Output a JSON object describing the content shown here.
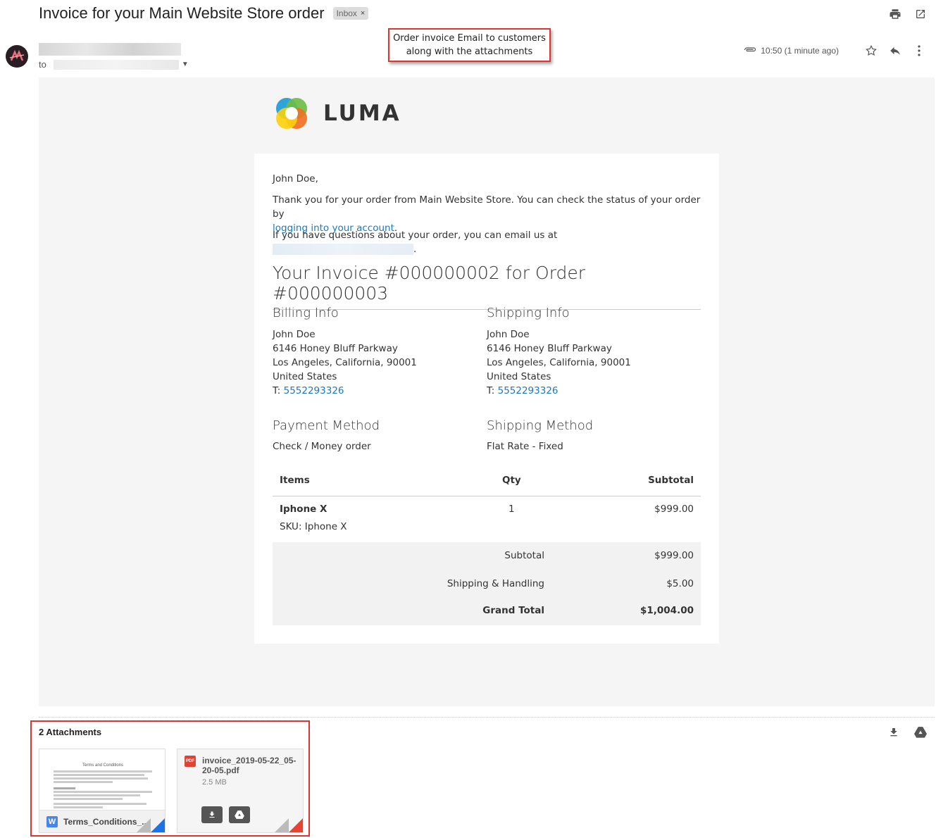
{
  "header": {
    "subject": "Invoice for your Main Website Store order",
    "label_chip": "Inbox",
    "chip_close": "×",
    "to_label": "to",
    "time": "10:50 (1 minute ago)"
  },
  "annotation": {
    "line1": "Order invoice Email to customers",
    "line2": "along with the attachments"
  },
  "email": {
    "brand": "LUMA",
    "greeting": "John Doe,",
    "thanks_line1": "Thank you for your order from Main Website Store. You can check the status of your order by",
    "login_link": "logging into your account",
    "period": ".",
    "questions": "If you have questions about your order, you can email us at",
    "invoice_title": "Your Invoice #000000002 for Order #000000003",
    "billing": {
      "heading": "Billing Info",
      "name": "John Doe",
      "street": "6146 Honey Bluff Parkway",
      "city": "Los Angeles, California, 90001",
      "country": "United States",
      "phone_prefix": "T:",
      "phone": "5552293326"
    },
    "shipping": {
      "heading": "Shipping Info",
      "name": "John Doe",
      "street": "6146 Honey Bluff Parkway",
      "city": "Los Angeles, California, 90001",
      "country": "United States",
      "phone_prefix": "T:",
      "phone": "5552293326"
    },
    "payment": {
      "heading": "Payment Method",
      "value": "Check / Money order"
    },
    "ship_method": {
      "heading": "Shipping Method",
      "value": "Flat Rate - Fixed"
    },
    "table": {
      "headers": [
        "Items",
        "Qty",
        "Subtotal"
      ],
      "rows": [
        {
          "name": "Iphone X",
          "sku": "SKU: Iphone X",
          "qty": "1",
          "subtotal": "$999.00"
        }
      ]
    },
    "totals": {
      "subtotal_label": "Subtotal",
      "subtotal": "$999.00",
      "shipping_label": "Shipping & Handling",
      "shipping": "$5.00",
      "grand_label": "Grand Total",
      "grand": "$1,004.00"
    }
  },
  "attachments": {
    "title": "2 Attachments",
    "files": [
      {
        "name": "Terms_Conditions_...",
        "type_letter": "W",
        "preview_title": "Terms and Conditions"
      },
      {
        "name": "invoice_2019-05-22_05-20-05.pdf",
        "type_letter": "PDF",
        "size": "2.5 MB"
      }
    ]
  },
  "colors": {
    "link": "#1979c3",
    "annotation_border": "#dd3333",
    "word_blue": "#4a86e8",
    "pdf_red": "#db4437"
  }
}
